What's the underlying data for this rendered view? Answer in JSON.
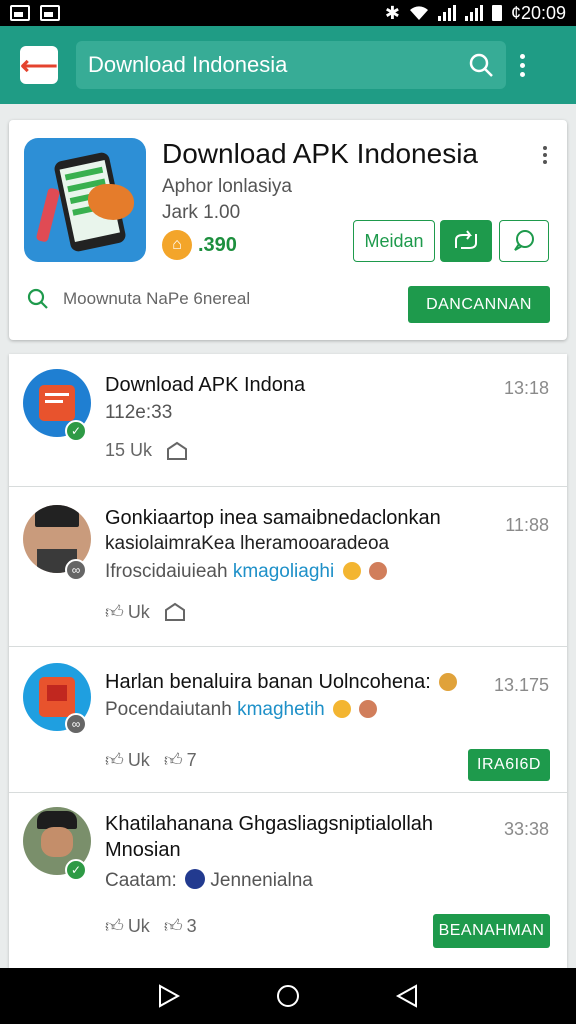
{
  "status_bar": {
    "time": "¢20:09"
  },
  "app_bar": {
    "search_text": "Download Indonesia"
  },
  "header": {
    "title": "Download APK Indonesia",
    "subtitle": "Aphor lonlasiya",
    "meta": "Jark 1.00",
    "count": ".390",
    "button_outline": "Meidan",
    "search_hint": "Moownuta NaPe 6nereal",
    "download_button": "DANCANNAN"
  },
  "posts": [
    {
      "title": "Download APK Indona",
      "line1": "112e:33",
      "time": "13:18",
      "like_label": "15 Uk",
      "share_count": ""
    },
    {
      "title": "Gonkiaartop inea samaibnedaclonkan",
      "line1": "kasiolaimraKea lheramooaradeoa",
      "line2_prefix": "Ifroscidaiuieah",
      "line2_tag": "kmagoliaghi",
      "time": "11:88",
      "like_label": "Uk",
      "share_count": ""
    },
    {
      "title": "Harlan benaluira banan Uolncohena:",
      "line1_prefix": "Pocendaiutanh",
      "line1_tag": "kmaghetih",
      "time": "13.175",
      "like_label": "Uk",
      "share_count": "7",
      "button": "IRA6I6D"
    },
    {
      "title": "Khatilahanana Ghgasliagsniptialollah",
      "line1": "Mnosian",
      "line2_prefix": "Caatam:",
      "line2_text": "Jennenialna",
      "time": "33:38",
      "like_label": "Uk",
      "share_count": "3",
      "button": "BEANAHMAN"
    }
  ],
  "colors": {
    "app_bar": "#1f9c85",
    "accent_green": "#1e9a4c",
    "link_blue": "#1e90c8"
  }
}
